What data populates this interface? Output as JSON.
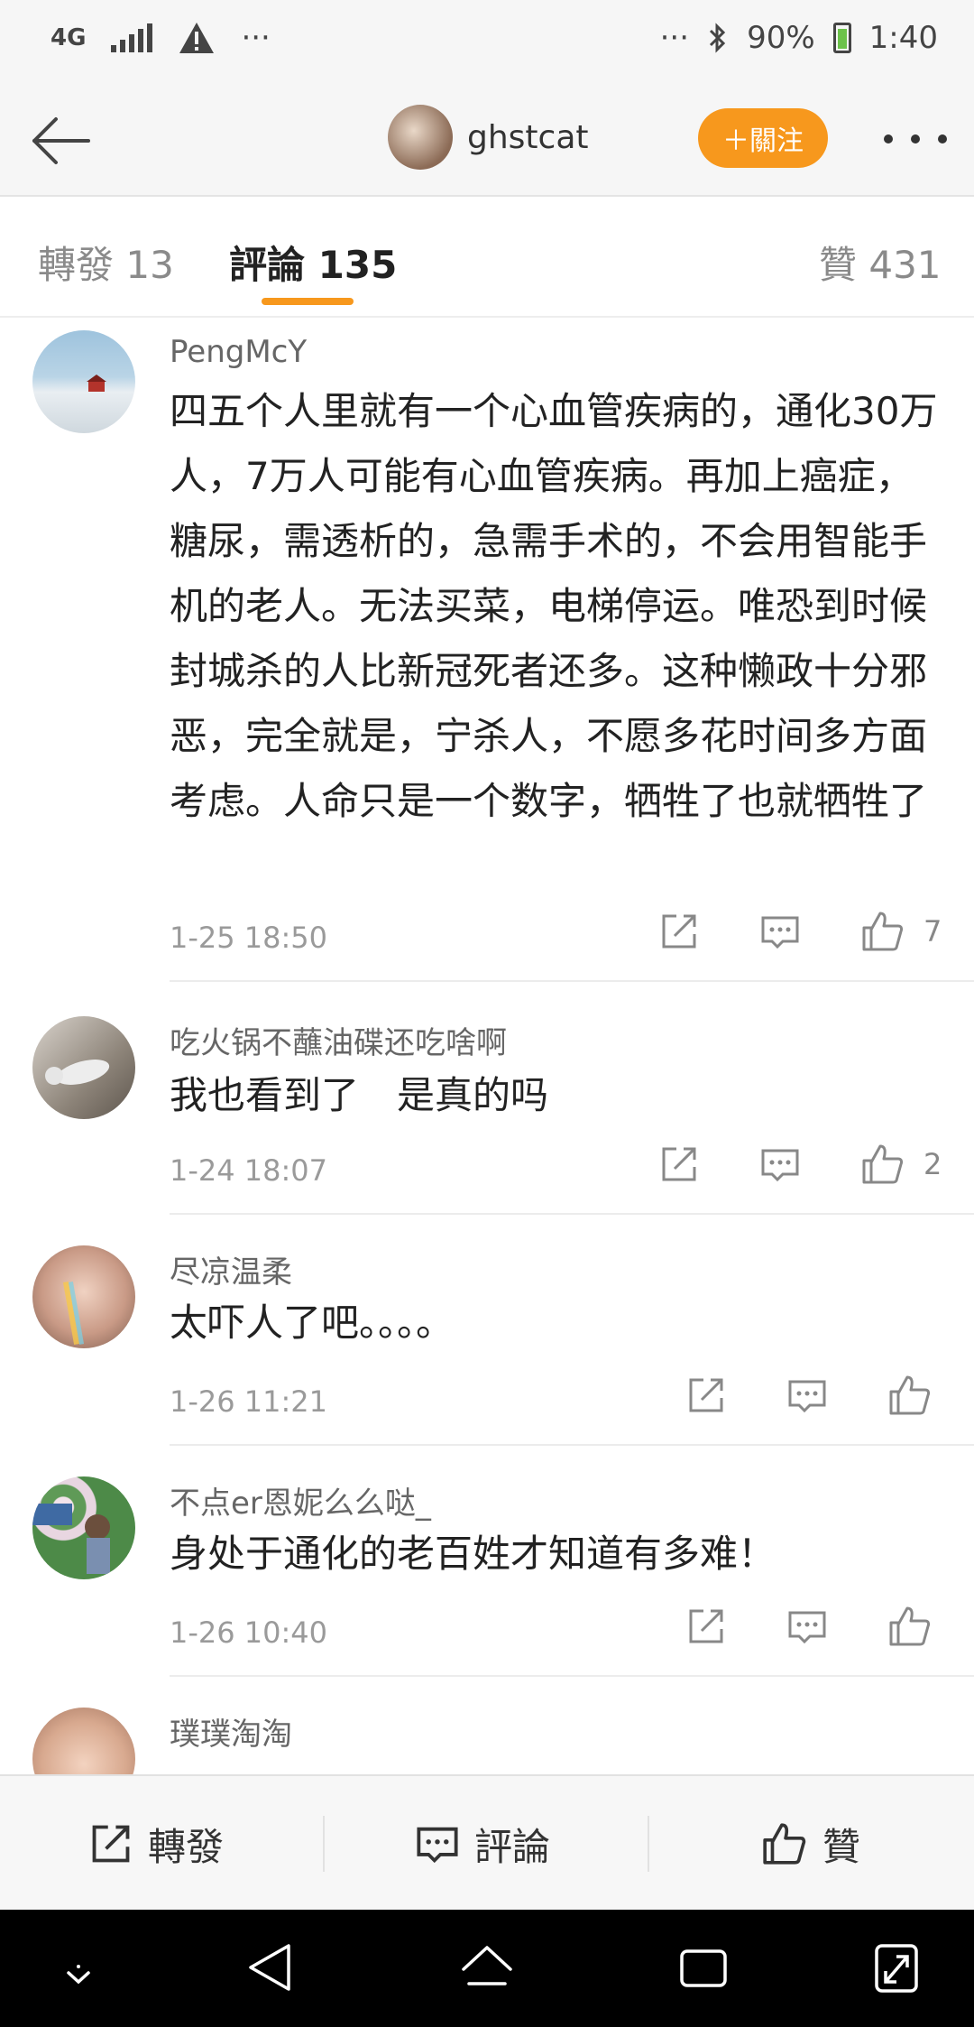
{
  "status_bar": {
    "network": "4G",
    "more_dots": "···",
    "right_dots": "···",
    "battery": "90%",
    "time": "1:40"
  },
  "header": {
    "username": "ghstcat",
    "follow_label": "＋關注"
  },
  "tabs": [
    {
      "label": "轉發 13"
    },
    {
      "label": "評論 135"
    },
    {
      "label": "贊 431"
    }
  ],
  "comments": [
    {
      "name": "PengMcY",
      "text": "四五个人里就有一个心血管疾病的，通化30万人，7万人可能有心血管疾病。再加上癌症，糖尿，需透析的，急需手术的，不会用智能手机的老人。无法买菜，电梯停运。唯恐到时候封城杀的人比新冠死者还多。这种懒政十分邪恶，完全就是，宁杀人，不愿多花时间多方面考虑。人命只是一个数字，牺牲了也就牺牲了",
      "time": "1-25 18:50",
      "likes": "7"
    },
    {
      "name": "吃火锅不蘸油碟还吃啥啊",
      "text": "我也看到了　是真的吗",
      "time": "1-24 18:07",
      "likes": "2"
    },
    {
      "name": "尽凉温柔",
      "text": "太吓人了吧。。。。",
      "time": "1-26 11:21",
      "likes": ""
    },
    {
      "name": "不点er恩妮么么哒_",
      "text": "身处于通化的老百姓才知道有多难！",
      "time": "1-26 10:40",
      "likes": ""
    },
    {
      "name": "璞璞淘淘",
      "text": "",
      "time": "",
      "likes": ""
    }
  ],
  "bottom_bar": {
    "repost": "轉發",
    "comment": "評論",
    "like": "贊"
  },
  "colors": {
    "accent": "#f7981d",
    "header_bg": "#f6f6f6"
  }
}
